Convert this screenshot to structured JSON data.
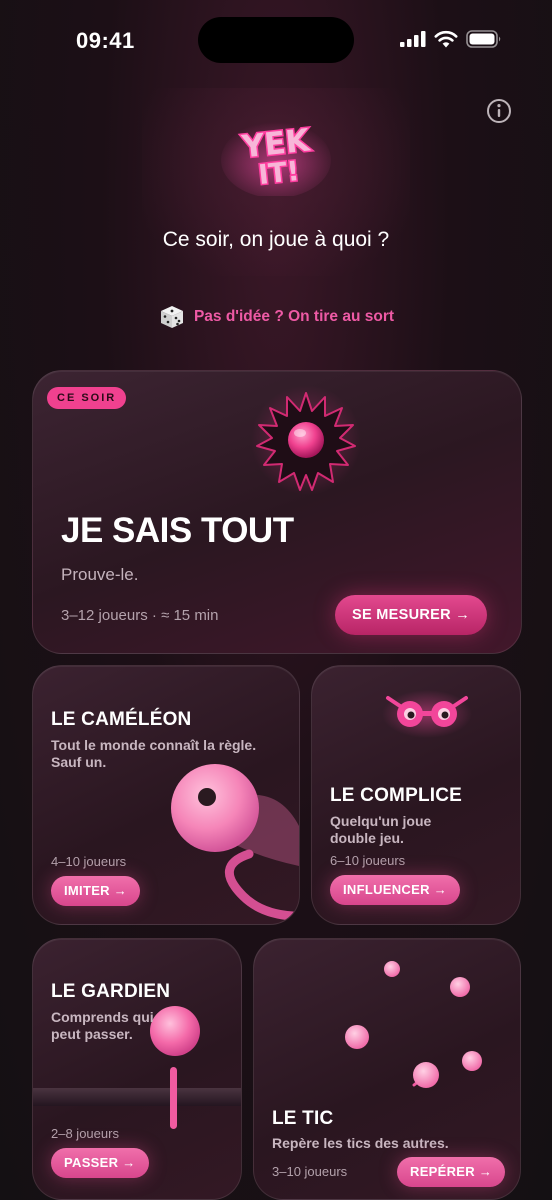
{
  "status_bar": {
    "time": "09:41"
  },
  "header": {
    "logo_text": [
      "YEK",
      "IT!"
    ],
    "tagline": "Ce soir, on joue à quoi ?",
    "random_label": "Pas d'idée ? On tire au sort"
  },
  "featured": {
    "badge": "CE SOIR",
    "title": "JE SAIS TOUT",
    "subtitle": "Prouve-le.",
    "meta": "3–12 joueurs · ≈ 15 min",
    "cta": "SE MESURER →"
  },
  "games": {
    "cameleon": {
      "title": "LE CAMÉLÉON",
      "desc_lines": [
        "Tout le monde connaît la règle.",
        "Sauf un."
      ],
      "meta": "4–10 joueurs",
      "cta": "IMITER →"
    },
    "complice": {
      "title": "LE COMPLICE",
      "desc_lines": [
        "Quelqu'un joue",
        "double jeu."
      ],
      "meta": "6–10 joueurs",
      "cta": "INFLUENCER →"
    },
    "gardien": {
      "title": "LE GARDIEN",
      "desc_lines": [
        "Comprends qui",
        "peut passer."
      ],
      "meta": "2–8 joueurs",
      "cta": "PASSER →"
    },
    "tic": {
      "title": "LE TIC",
      "desc_lines": [
        "Repère les tics des autres."
      ],
      "meta": "3–10 joueurs",
      "cta": "REPÉRER →"
    }
  },
  "colors": {
    "accent": "#f0418f",
    "accent_text": "#ee5aa5",
    "background": "#1c0f16"
  },
  "icons": [
    "signal-icon",
    "wifi-icon",
    "battery-icon",
    "info-icon",
    "dice-icon"
  ]
}
